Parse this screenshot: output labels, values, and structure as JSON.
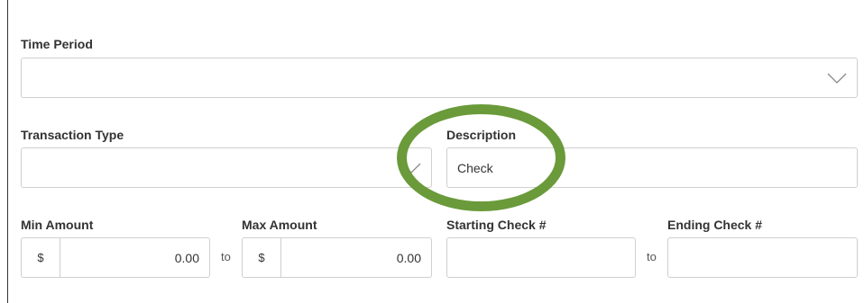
{
  "form": {
    "time_period": {
      "label": "Time Period",
      "value": "",
      "chevron_icon": "chevron-down-icon"
    },
    "transaction_type": {
      "label": "Transaction Type",
      "value": "",
      "chevron_icon": "chevron-down-icon"
    },
    "description": {
      "label": "Description",
      "value": "Check"
    },
    "min_amount": {
      "label": "Min Amount",
      "prefix": "$",
      "value": "0.00"
    },
    "max_amount": {
      "label": "Max Amount",
      "prefix": "$",
      "value": "0.00"
    },
    "range_separator": "to",
    "starting_check": {
      "label": "Starting Check #",
      "value": ""
    },
    "ending_check": {
      "label": "Ending Check #",
      "value": ""
    }
  },
  "annotation": {
    "ring_color": "#6a9a3a"
  }
}
